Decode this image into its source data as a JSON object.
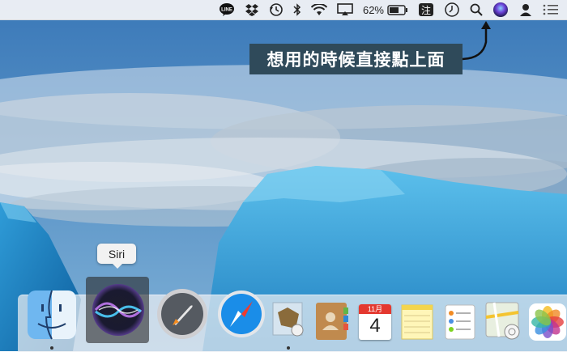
{
  "menubar": {
    "items": [
      "line-icon",
      "dropbox-icon",
      "time-machine-icon",
      "bluetooth-icon",
      "wifi-icon",
      "airplay-icon",
      "battery",
      "input-method-icon",
      "clock-icon",
      "spotlight-icon",
      "siri-icon",
      "user-icon",
      "notification-center-icon"
    ],
    "battery_percent": "62%",
    "line_label": "LINE",
    "input_method_label": "注"
  },
  "annotation": {
    "text": "想用的時候直接點上面"
  },
  "dock": {
    "tooltip": "Siri",
    "apps": [
      "Finder",
      "Siri",
      "Launchpad",
      "Safari",
      "Mail",
      "Contacts",
      "Calendar",
      "Notes",
      "Reminders",
      "Maps",
      "Photos"
    ],
    "calendar_month": "11月",
    "calendar_day": "4"
  },
  "colors": {
    "annotation_bg": "#2f4a5a",
    "sky": "#4f86bd",
    "ice": "#3fa7d8"
  }
}
